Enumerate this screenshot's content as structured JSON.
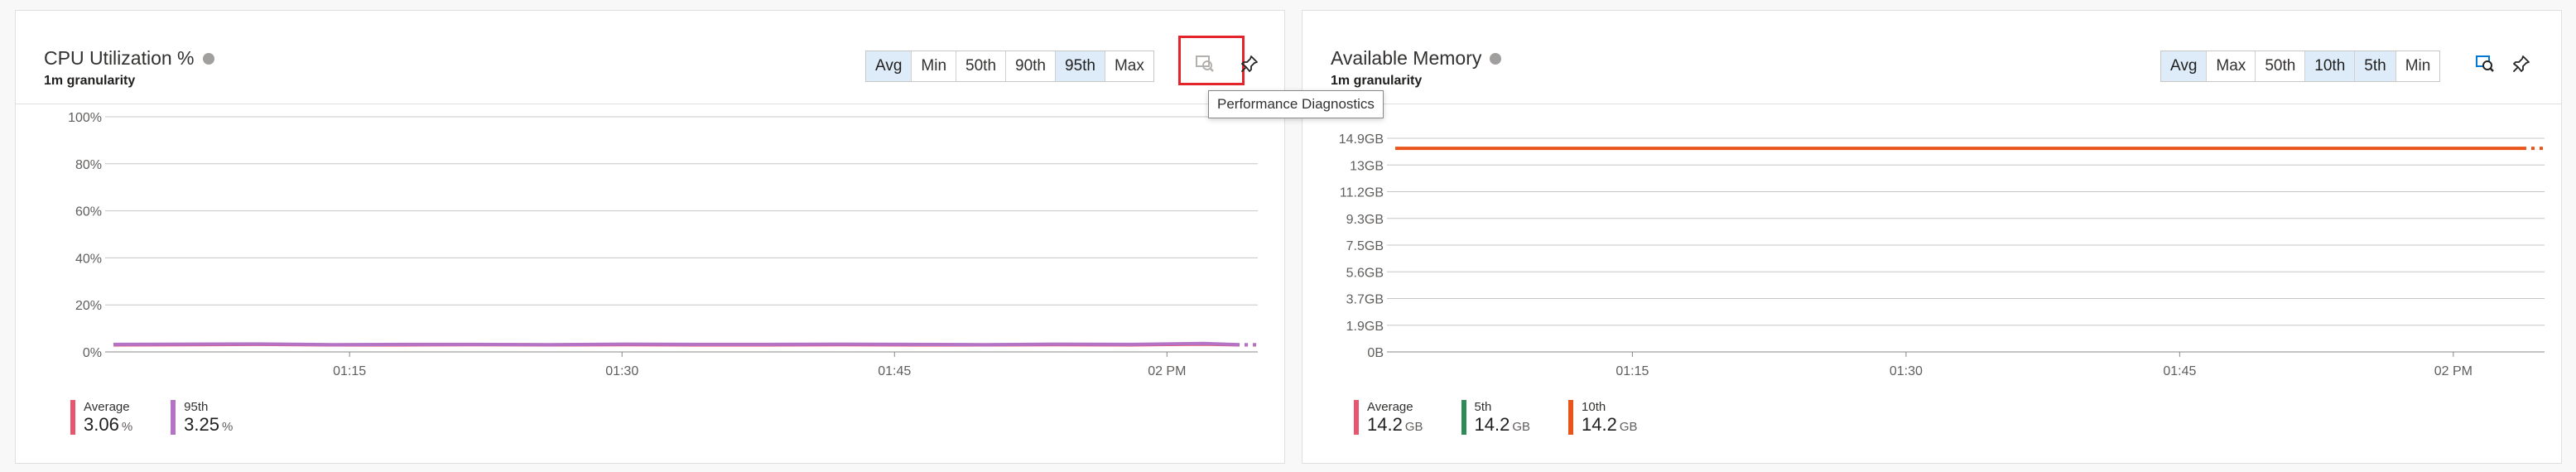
{
  "cpu": {
    "title": "CPU Utilization %",
    "granularity": "1m granularity",
    "aggregations": [
      {
        "label": "Avg",
        "active": true
      },
      {
        "label": "Min",
        "active": false
      },
      {
        "label": "50th",
        "active": false
      },
      {
        "label": "90th",
        "active": false
      },
      {
        "label": "95th",
        "active": true
      },
      {
        "label": "Max",
        "active": false
      }
    ],
    "tooltip": "Performance Diagnostics",
    "legend": [
      {
        "name": "Average",
        "value": "3.06",
        "unit": "%",
        "color": "#e8556e"
      },
      {
        "name": "95th",
        "value": "3.25",
        "unit": "%",
        "color": "#b573c6"
      }
    ]
  },
  "memory": {
    "title": "Available Memory",
    "granularity": "1m granularity",
    "aggregations": [
      {
        "label": "Avg",
        "active": true
      },
      {
        "label": "Max",
        "active": false
      },
      {
        "label": "50th",
        "active": false
      },
      {
        "label": "10th",
        "active": true
      },
      {
        "label": "5th",
        "active": true
      },
      {
        "label": "Min",
        "active": false
      }
    ],
    "legend": [
      {
        "name": "Average",
        "value": "14.2",
        "unit": "GB",
        "color": "#e8556e"
      },
      {
        "name": "5th",
        "value": "14.2",
        "unit": "GB",
        "color": "#2e8b57"
      },
      {
        "name": "10th",
        "value": "14.2",
        "unit": "GB",
        "color": "#e8541a"
      }
    ]
  },
  "chart_data": [
    {
      "type": "line",
      "title": "CPU Utilization %",
      "x_ticks": [
        "01:15",
        "01:30",
        "01:45",
        "02 PM"
      ],
      "x_range": [
        "01:02",
        "02:05"
      ],
      "y_ticks": [
        "100%",
        "80%",
        "60%",
        "40%",
        "20%",
        "0%"
      ],
      "ylim": [
        0,
        100
      ],
      "grid": true,
      "series": [
        {
          "name": "Average",
          "color": "#e8556e",
          "x": [
            "01:02",
            "01:06",
            "01:10",
            "01:14",
            "01:18",
            "01:22",
            "01:26",
            "01:30",
            "01:34",
            "01:38",
            "01:42",
            "01:46",
            "01:50",
            "01:54",
            "01:58",
            "02:02",
            "02:04"
          ],
          "values": [
            3.0,
            3.1,
            3.2,
            3.0,
            3.0,
            3.1,
            3.0,
            3.1,
            3.0,
            3.0,
            3.1,
            3.0,
            3.0,
            3.1,
            3.0,
            3.3,
            3.0
          ]
        },
        {
          "name": "95th",
          "color": "#b573c6",
          "x": [
            "01:02",
            "01:06",
            "01:10",
            "01:14",
            "01:18",
            "01:22",
            "01:26",
            "01:30",
            "01:34",
            "01:38",
            "01:42",
            "01:46",
            "01:50",
            "01:54",
            "01:58",
            "02:02",
            "02:04"
          ],
          "values": [
            3.2,
            3.3,
            3.4,
            3.1,
            3.2,
            3.2,
            3.1,
            3.3,
            3.2,
            3.2,
            3.3,
            3.2,
            3.1,
            3.3,
            3.2,
            3.6,
            3.1
          ]
        }
      ]
    },
    {
      "type": "line",
      "title": "Available Memory",
      "x_ticks": [
        "01:15",
        "01:30",
        "01:45",
        "02 PM"
      ],
      "x_range": [
        "01:02",
        "02:05"
      ],
      "y_ticks": [
        "14.9GB",
        "13GB",
        "11.2GB",
        "9.3GB",
        "7.5GB",
        "5.6GB",
        "3.7GB",
        "1.9GB",
        "0B"
      ],
      "ylim": [
        0,
        14.9
      ],
      "grid": true,
      "series": [
        {
          "name": "10th",
          "color": "#e8541a",
          "x": [
            "01:02",
            "01:06",
            "01:10",
            "01:14",
            "01:18",
            "01:22",
            "01:26",
            "01:30",
            "01:34",
            "01:38",
            "01:42",
            "01:46",
            "01:50",
            "01:54",
            "01:58",
            "02:02",
            "02:04"
          ],
          "values": [
            14.2,
            14.2,
            14.2,
            14.2,
            14.2,
            14.2,
            14.2,
            14.2,
            14.2,
            14.2,
            14.2,
            14.2,
            14.2,
            14.2,
            14.2,
            14.2,
            14.2
          ]
        }
      ]
    }
  ]
}
